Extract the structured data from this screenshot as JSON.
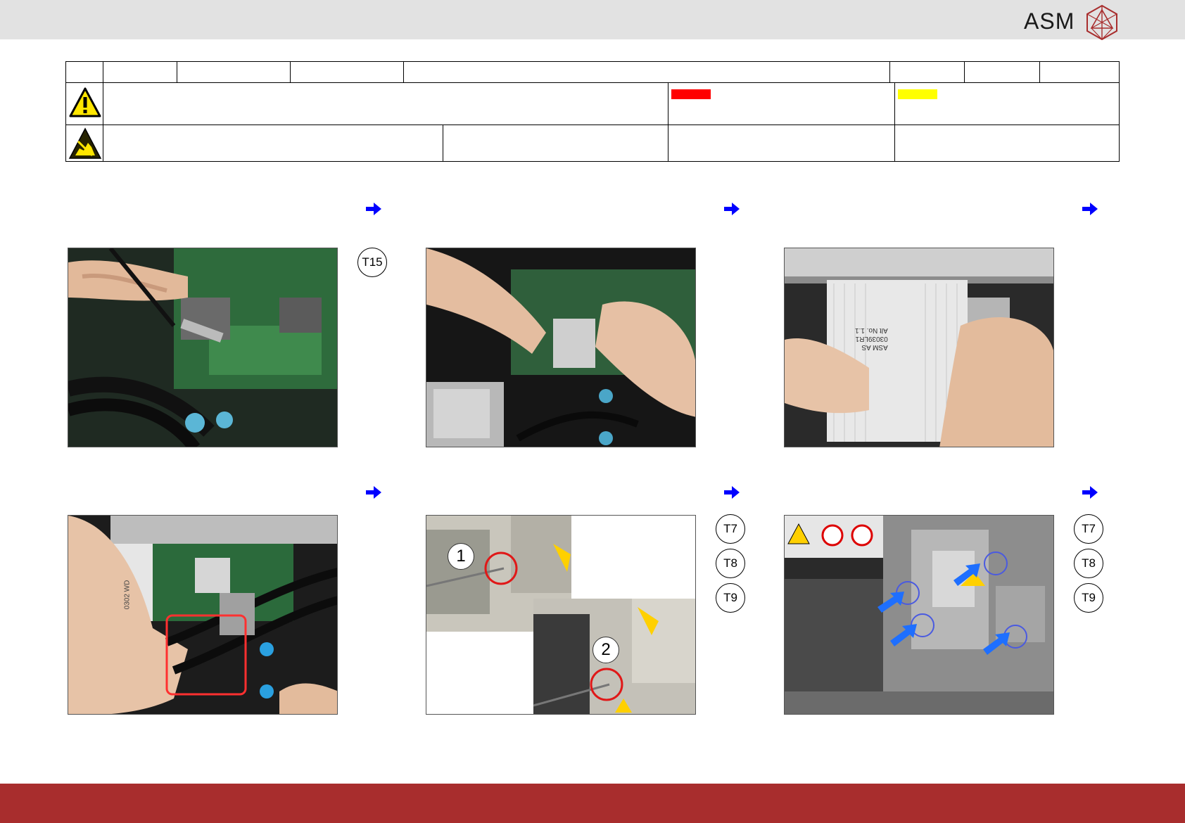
{
  "header": {
    "brand": "ASM"
  },
  "colors": {
    "top_bar": "#e2e2e2",
    "footer_bar": "#a82d2d",
    "danger_swatch": "#ff0000",
    "caution_swatch": "#ffff00",
    "step_arrow": "#0000ff"
  },
  "icons": {
    "warning": "warning-triangle-icon",
    "esd": "esd-hand-icon",
    "next": "arrow-right-icon"
  },
  "steps": [
    {
      "tools": [
        "T15"
      ],
      "callouts": []
    },
    {
      "tools": [],
      "callouts": []
    },
    {
      "tools": [],
      "callouts": [],
      "label_lines": [
        "ASM AS",
        "03039LR1",
        "Alt No. 1.1"
      ]
    },
    {
      "tools": [],
      "callouts": [],
      "label_lines": [
        "0302 WD"
      ]
    },
    {
      "tools": [
        "T7",
        "T8",
        "T9"
      ],
      "callouts": [
        "1",
        "2"
      ]
    },
    {
      "tools": [
        "T7",
        "T8",
        "T9"
      ],
      "callouts": []
    }
  ]
}
